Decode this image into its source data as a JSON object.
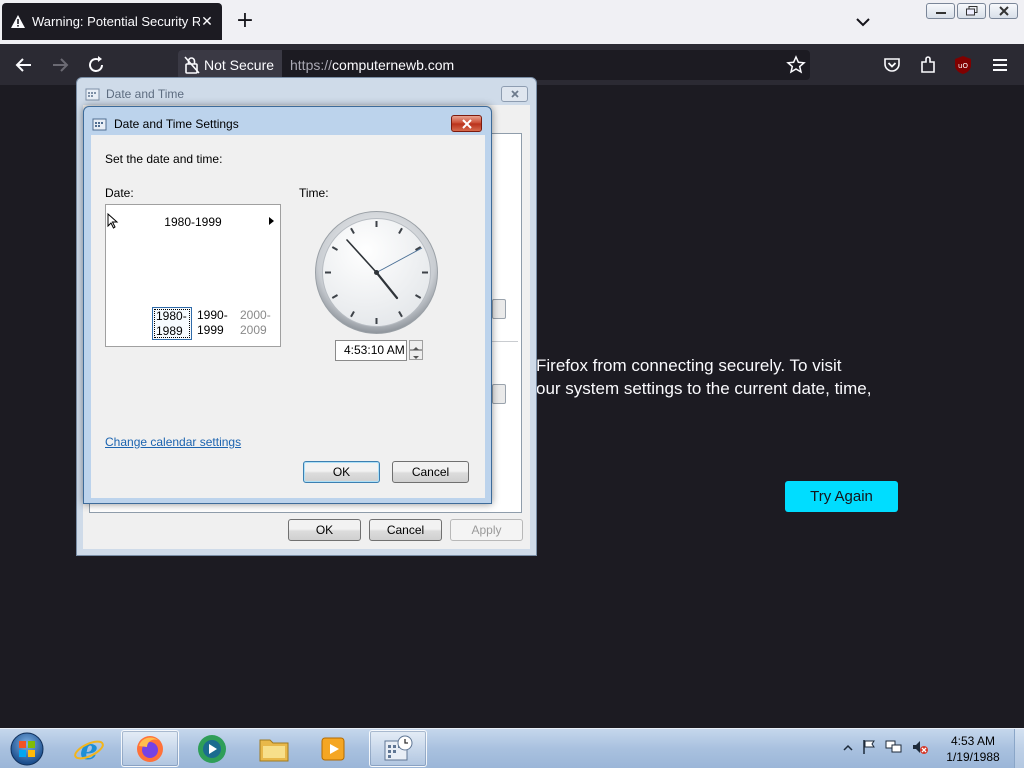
{
  "browser": {
    "tab_title": "Warning: Potential Security Risk",
    "url_scheme": "https://",
    "url_host": "computernewb.com",
    "security_label": "Not Secure"
  },
  "page": {
    "text_line1": "Firefox from connecting securely. To visit",
    "text_line2": "our system settings to the current date, time,",
    "try_again": "Try Again"
  },
  "outer_dialog": {
    "title": "Date and Time",
    "ok": "OK",
    "cancel": "Cancel",
    "apply": "Apply"
  },
  "inner_dialog": {
    "title": "Date and Time Settings",
    "instruction": "Set the date and time:",
    "date_label": "Date:",
    "time_label": "Time:",
    "calendar_header": "1980-1999",
    "decades": [
      {
        "line1": "1980-",
        "line2": "1989"
      },
      {
        "line1": "1990-",
        "line2": "1999"
      },
      {
        "line1": "2000-",
        "line2": "2009"
      }
    ],
    "time_value": "4:53:10 AM",
    "change_calendar_link": "Change calendar settings",
    "ok": "OK",
    "cancel": "Cancel"
  },
  "taskbar": {
    "time": "4:53 AM",
    "date": "1/19/1988",
    "items": [
      "internet-explorer",
      "firefox",
      "media-center",
      "file-explorer",
      "media-player",
      "date-time-settings"
    ]
  },
  "colors": {
    "accent_try_again": "#00ddff",
    "page_bg": "#1c1b22",
    "link": "#1c64b0"
  }
}
